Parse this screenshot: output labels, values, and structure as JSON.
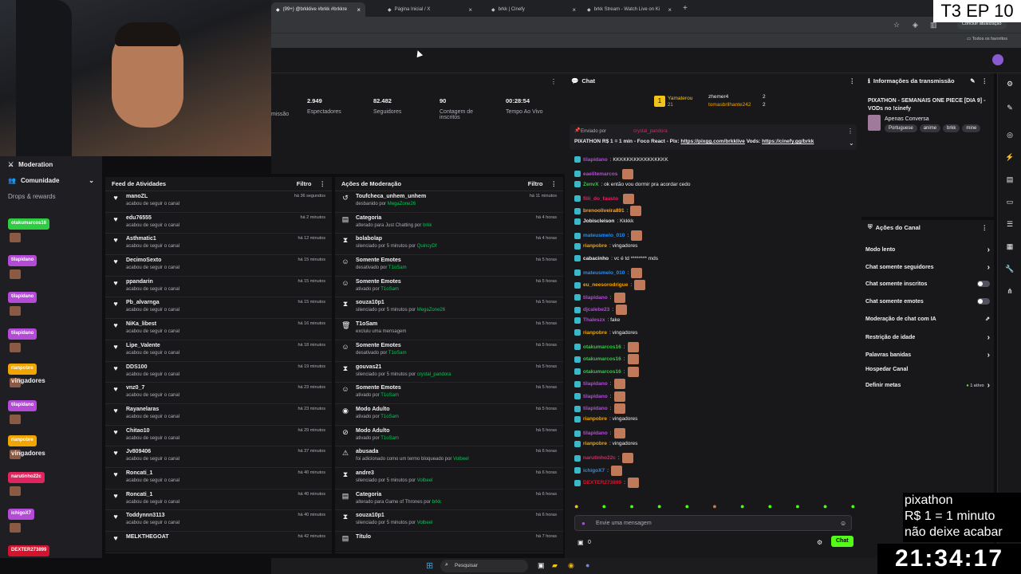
{
  "browser": {
    "tabs": [
      {
        "label": "(99+) @brkklive #brkk #brkkre",
        "active": true
      },
      {
        "label": "Página Inicial / X",
        "active": false
      },
      {
        "label": "brkk | Cinefy",
        "active": false
      },
      {
        "label": "brkk Stream - Watch Live on Ki",
        "active": false
      }
    ],
    "update_button": "Concluir atualização",
    "bookmarks_label": "Todos os favoritos"
  },
  "overlay": {
    "episode": "T3 EP 10",
    "pixathon_lines": [
      "pixathon",
      "R$ 1 = 1 minuto",
      "não deixe acabar"
    ],
    "clock": "21:34:17"
  },
  "leftnav": {
    "moderation": "Moderation",
    "comunidade": "Comunidade",
    "drops": "Drops & rewards",
    "chips": [
      {
        "label": "otakumarcos16",
        "color": "#2ecc40"
      },
      {
        "label": "tilapidano",
        "color": "#b34bd6"
      },
      {
        "label": "tilapidano",
        "color": "#b34bd6"
      },
      {
        "label": "tilapidano",
        "color": "#b34bd6"
      },
      {
        "label": "rianpobre",
        "color": "#f0a500"
      },
      {
        "label": "tilapidano",
        "color": "#b34bd6"
      },
      {
        "label": "rianpobre",
        "color": "#f0a500"
      },
      {
        "label": "narutinho22c",
        "color": "#e0245e"
      },
      {
        "label": "ichigoX7",
        "color": "#b34bd6"
      },
      {
        "label": "DEXTER273899",
        "color": "#d4142f"
      }
    ],
    "vingadores": "vingadores"
  },
  "stats": {
    "partial_label": "missão",
    "items": [
      {
        "value": "2.949",
        "label": "Espectadores"
      },
      {
        "value": "82.482",
        "label": "Seguidores"
      },
      {
        "value": "90",
        "label": "Contagem de inscritos"
      },
      {
        "value": "00:28:54",
        "label": "Tempo Ao Vivo"
      }
    ]
  },
  "feed": {
    "title": "Feed de Atividades",
    "filter": "Filtro",
    "items": [
      {
        "name": "manoZL",
        "action": "acabou de seguir o canal",
        "time": "há 36 segundos"
      },
      {
        "name": "edu76555",
        "action": "acabou de seguir o canal",
        "time": "há 2 minutos"
      },
      {
        "name": "Asthmatic1",
        "action": "acabou de seguir o canal",
        "time": "há 12 minutos"
      },
      {
        "name": "DecimoSexto",
        "action": "acabou de seguir o canal",
        "time": "há 15 minutos"
      },
      {
        "name": "ppandarin",
        "action": "acabou de seguir o canal",
        "time": "há 15 minutos"
      },
      {
        "name": "Pb_alvarnga",
        "action": "acabou de seguir o canal",
        "time": "há 15 minutos"
      },
      {
        "name": "NiKa_libest",
        "action": "acabou de seguir o canal",
        "time": "há 16 minutos"
      },
      {
        "name": "Lipe_Valente",
        "action": "acabou de seguir o canal",
        "time": "há 18 minutos"
      },
      {
        "name": "DDS100",
        "action": "acabou de seguir o canal",
        "time": "há 19 minutos"
      },
      {
        "name": "vnz0_7",
        "action": "acabou de seguir o canal",
        "time": "há 23 minutos"
      },
      {
        "name": "Rayanelaras",
        "action": "acabou de seguir o canal",
        "time": "há 23 minutos"
      },
      {
        "name": "Chitao10",
        "action": "acabou de seguir o canal",
        "time": "há 29 minutos"
      },
      {
        "name": "Jv809406",
        "action": "acabou de seguir o canal",
        "time": "há 37 minutos"
      },
      {
        "name": "Roncati_1",
        "action": "acabou de seguir o canal",
        "time": "há 40 minutos"
      },
      {
        "name": "Roncati_1",
        "action": "acabou de seguir o canal",
        "time": "há 40 minutos"
      },
      {
        "name": "Toddynnn3113",
        "action": "acabou de seguir o canal",
        "time": "há 40 minutos"
      },
      {
        "name": "MELKTHEGOAT",
        "action": "",
        "time": "há 42 minutos"
      }
    ]
  },
  "modactions": {
    "title": "Ações de Moderação",
    "filter": "Filtro",
    "items": [
      {
        "icon": "↺",
        "name": "Toufcheca_unhem_unhem",
        "pre": "desbanido por ",
        "by": "MegaZone26",
        "time": "há 11 minutos"
      },
      {
        "icon": "▤",
        "name": "Categoria",
        "pre": "alterado para Just Chatting por ",
        "by": "brkk",
        "time": "há 4 horas"
      },
      {
        "icon": "⧗",
        "name": "bolabolap",
        "pre": "silenciado por 5 minutos por ",
        "by": "QuincyDf",
        "time": "há 4 horas"
      },
      {
        "icon": "☺",
        "name": "Somente Emotes",
        "pre": "desativado por ",
        "by": "T1oSam",
        "time": "há 5 horas"
      },
      {
        "icon": "☺",
        "name": "Somente Emotes",
        "pre": "ativado por ",
        "by": "T1oSam",
        "time": "há 5 horas"
      },
      {
        "icon": "⧗",
        "name": "souza10p1",
        "pre": "silenciado por 5 minutos por ",
        "by": "MegaZone26",
        "time": "há 5 horas"
      },
      {
        "icon": "🗑",
        "name": "T1oSam",
        "pre": "excluiu uma mensagem",
        "by": "",
        "time": "há 5 horas"
      },
      {
        "icon": "☺",
        "name": "Somente Emotes",
        "pre": "desativado por ",
        "by": "T1oSam",
        "time": "há 5 horas"
      },
      {
        "icon": "⧗",
        "name": "gouvas21",
        "pre": "silenciado por 5 minutos por ",
        "by": "crystal_pandora",
        "time": "há 5 horas"
      },
      {
        "icon": "☺",
        "name": "Somente Emotes",
        "pre": "ativado por ",
        "by": "T1oSam",
        "time": "há 5 horas"
      },
      {
        "icon": "◉",
        "name": "Modo Adulto",
        "pre": "ativado por ",
        "by": "T1oSam",
        "time": "há 5 horas"
      },
      {
        "icon": "⊘",
        "name": "Modo Adulto",
        "pre": "ativado por ",
        "by": "T1oSam",
        "time": "há 5 horas"
      },
      {
        "icon": "⚠",
        "name": "abusada",
        "pre": "foi adicionado como um termo bloqueado por ",
        "by": "Volbeel",
        "time": "há 6 horas"
      },
      {
        "icon": "⧗",
        "name": "andre3",
        "pre": "silenciado por 5 minutos por ",
        "by": "Volbeel",
        "time": "há 6 horas"
      },
      {
        "icon": "▤",
        "name": "Categoria",
        "pre": "alterado para Game of Thrones por ",
        "by": "brkk",
        "time": "há 6 horas"
      },
      {
        "icon": "⧗",
        "name": "souza10p1",
        "pre": "silenciado por 5 minutos por ",
        "by": "Volbeel",
        "time": "há 6 horas"
      },
      {
        "icon": "▤",
        "name": "Título",
        "pre": "",
        "by": "",
        "time": "há 7 horas"
      }
    ]
  },
  "chat": {
    "title": "Chat",
    "leaders": [
      {
        "name": "Yamaterou",
        "count": "21"
      },
      {
        "name": "zhemer4",
        "count": "2"
      },
      {
        "name": "tomasbrilhante242",
        "count": "2"
      }
    ],
    "pinned_by_prefix": "Enviado por",
    "pinned_by": "crystal_pandora",
    "pinned_text": "PIXATHON R$ 1 = 1 min - Foco React - Pix:",
    "pinned_link1": "https://pixgg.com/brkklive",
    "pinned_mid": " Vods:",
    "pinned_link2": "https://cinefy.gg/brkk",
    "messages": [
      {
        "user": "tilapidano",
        "color": "#b34bd6",
        "text": ": KKKKKKKKKKKKKKKK"
      },
      {
        "user": "eaelitemarcos",
        "color": "#b34bd6",
        "text": ""
      },
      {
        "user": "ZenvX",
        "color": "#2ecc40",
        "text": ": ok então vou dormir pra acordar cedo"
      },
      {
        "user": "filii_do_fausto",
        "color": "#e0245e",
        "text": ""
      },
      {
        "user": "brenooliveira891",
        "color": "#f7a334",
        "text": ":"
      },
      {
        "user": "Jobiscleison",
        "color": "#efeff1",
        "text": ": Kkkkk"
      },
      {
        "user": "mateusmelo_010",
        "color": "#1e90ff",
        "text": ":"
      },
      {
        "user": "rianpobre",
        "color": "#f0a500",
        "text": ": vingadores"
      },
      {
        "user": "cabacinho",
        "color": "#efeff1",
        "text": ": vc é td ******** mds"
      },
      {
        "user": "mateusmelo_010",
        "color": "#1e90ff",
        "text": ":"
      },
      {
        "user": "eu_neesorodrigue",
        "color": "#f0a500",
        "text": ":"
      },
      {
        "user": "tilapidano",
        "color": "#b34bd6",
        "text": ":"
      },
      {
        "user": "djcalebe23",
        "color": "#b34bd6",
        "text": ":"
      },
      {
        "user": "Thaleszx",
        "color": "#b34bd6",
        "text": ": fake"
      },
      {
        "user": "rianpobre",
        "color": "#f0a500",
        "text": ": vingadores"
      },
      {
        "user": "otakumarcos16",
        "color": "#2ecc40",
        "text": ":"
      },
      {
        "user": "otakumarcos16",
        "color": "#2ecc40",
        "text": ":"
      },
      {
        "user": "otakumarcos16",
        "color": "#2ecc40",
        "text": ":"
      },
      {
        "user": "tilapidano",
        "color": "#b34bd6",
        "text": ":"
      },
      {
        "user": "tilapidano",
        "color": "#b34bd6",
        "text": ":"
      },
      {
        "user": "tilapidano",
        "color": "#b34bd6",
        "text": ":"
      },
      {
        "user": "rianpobre",
        "color": "#f0a500",
        "text": ": vingadores"
      },
      {
        "user": "tilapidano",
        "color": "#b34bd6",
        "text": ":"
      },
      {
        "user": "rianpobre",
        "color": "#f0a500",
        "text": ": vingadores"
      },
      {
        "user": "narutinho22c",
        "color": "#e0245e",
        "text": ":"
      },
      {
        "user": "ichigoX7",
        "color": "#1e90ff",
        "text": ":"
      },
      {
        "user": "DEXTER273899",
        "color": "#d4142f",
        "text": ":"
      }
    ],
    "input_placeholder": "Envie uma mensagem",
    "viewer_count": "0",
    "send_button": "Chat"
  },
  "info": {
    "title": "Informações da transmissão",
    "stream_title": "PIXATHON - SEMANAIS ONE PIECE [DIA 9] - VODs no !cinefy",
    "category": "Apenas Conversa",
    "tags": [
      "Portuguese",
      "anime",
      "brkk",
      "mine"
    ]
  },
  "channel_actions": {
    "title": "Ações do Canal",
    "items": [
      {
        "label": "Modo lento",
        "control": "chevron"
      },
      {
        "label": "Chat somente seguidores",
        "control": "chevron"
      },
      {
        "label": "Chat somente inscritos",
        "control": "toggle"
      },
      {
        "label": "Chat somente emotes",
        "control": "toggle"
      },
      {
        "label": "Moderação de chat com IA",
        "control": "external"
      },
      {
        "label": "Restrição de idade",
        "control": "chevron"
      },
      {
        "label": "Palavras banidas",
        "control": "chevron"
      },
      {
        "label": "Hospedar Canal",
        "control": "none"
      },
      {
        "label": "Definir metas",
        "control": "chevron"
      }
    ],
    "metas_badge": "1 ativo"
  },
  "taskbar": {
    "search": "Pesquisar"
  },
  "colors": {
    "accent": "#53fc18",
    "bg": "#18181b",
    "page": "#0e0e10"
  }
}
